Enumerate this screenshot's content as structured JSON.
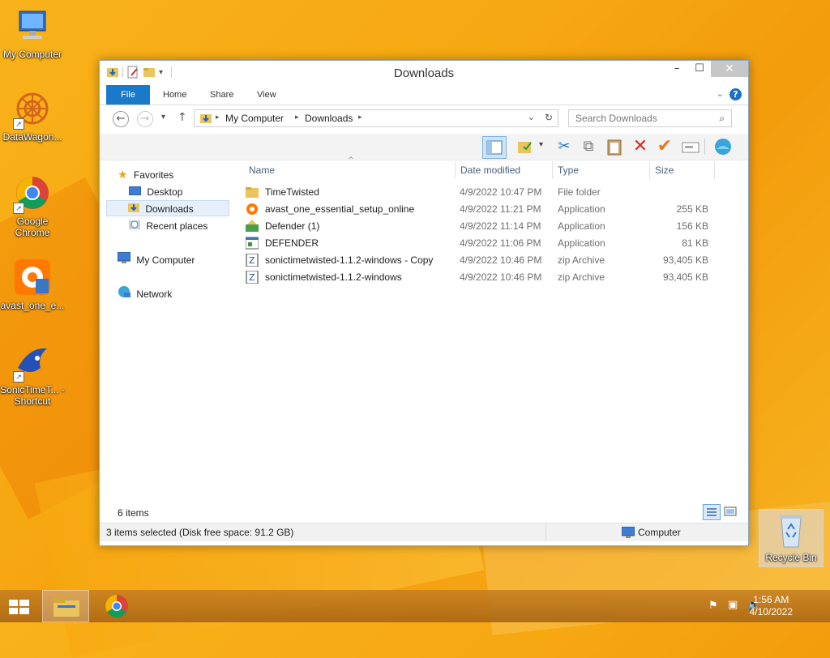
{
  "desktop": {
    "icons": [
      {
        "label": "My Computer",
        "icon": "computer-icon"
      },
      {
        "label": "DataWagon...",
        "icon": "datawagon-icon"
      },
      {
        "label": "Google Chrome",
        "icon": "chrome-icon"
      },
      {
        "label": "avast_one_e...",
        "icon": "avast-icon"
      },
      {
        "label": "SonicTimeT... - Shortcut",
        "icon": "sonic-icon"
      },
      {
        "label": "Recycle Bin",
        "icon": "recycle-bin-icon"
      }
    ]
  },
  "window": {
    "title": "Downloads",
    "ribbon_tabs": [
      "File",
      "Home",
      "Share",
      "View"
    ],
    "address": {
      "root": "My Computer",
      "current": "Downloads"
    },
    "search_placeholder": "Search Downloads",
    "nav": {
      "favorites": "Favorites",
      "desktop": "Desktop",
      "downloads": "Downloads",
      "recent": "Recent places",
      "computer": "My Computer",
      "network": "Network"
    },
    "columns": [
      "Name",
      "Date modified",
      "Type",
      "Size"
    ],
    "files": [
      {
        "name": "TimeTwisted",
        "date": "4/9/2022 10:47 PM",
        "type": "File folder",
        "size": "",
        "icon": "folder-icon"
      },
      {
        "name": "avast_one_essential_setup_online",
        "date": "4/9/2022 11:21 PM",
        "type": "Application",
        "size": "255 KB",
        "icon": "avast-app-icon"
      },
      {
        "name": "Defender (1)",
        "date": "4/9/2022 11:14 PM",
        "type": "Application",
        "size": "156 KB",
        "icon": "defender-app-icon"
      },
      {
        "name": "DEFENDER",
        "date": "4/9/2022 11:06 PM",
        "type": "Application",
        "size": "81 KB",
        "icon": "app-window-icon"
      },
      {
        "name": "sonictimetwisted-1.1.2-windows - Copy",
        "date": "4/9/2022 10:46 PM",
        "type": "zip Archive",
        "size": "93,405 KB",
        "icon": "zip-icon"
      },
      {
        "name": "sonictimetwisted-1.1.2-windows",
        "date": "4/9/2022 10:46 PM",
        "type": "zip Archive",
        "size": "93,405 KB",
        "icon": "zip-icon"
      }
    ],
    "item_count": "6 items",
    "status": "3 items selected (Disk free space: 91.2 GB)",
    "status_location": "Computer"
  },
  "taskbar": {
    "time": "1:56 AM",
    "date": "4/10/2022"
  }
}
